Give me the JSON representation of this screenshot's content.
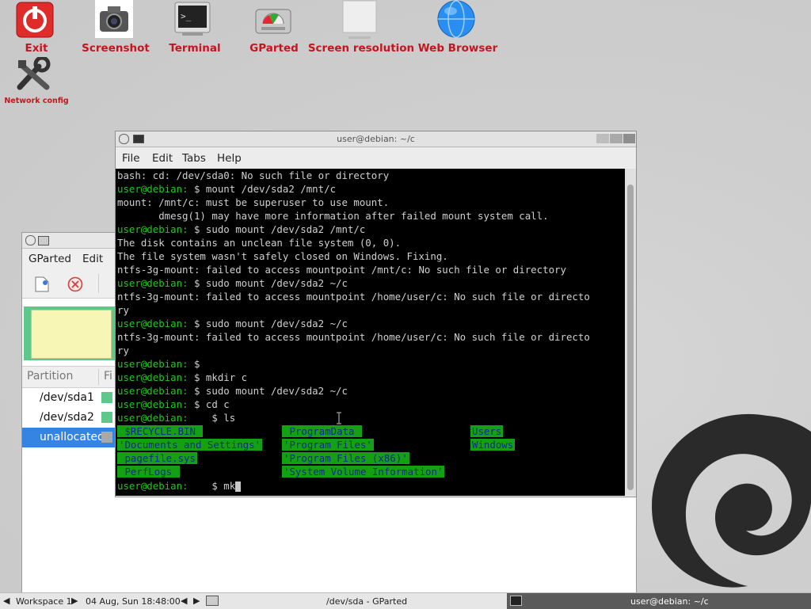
{
  "desktop": {
    "icons": [
      {
        "id": "exit",
        "label": "Exit",
        "icon": "power-icon"
      },
      {
        "id": "screenshot",
        "label": "Screenshot",
        "icon": "camera-icon"
      },
      {
        "id": "terminal",
        "label": "Terminal",
        "icon": "terminal-icon"
      },
      {
        "id": "gparted",
        "label": "GParted",
        "icon": "disk-icon"
      },
      {
        "id": "screen-resolution",
        "label": "Screen resolution",
        "icon": "monitor-icon"
      },
      {
        "id": "web-browser",
        "label": "Web Browser",
        "icon": "globe-icon"
      },
      {
        "id": "network-config",
        "label": "Network config",
        "icon": "tools-icon"
      }
    ]
  },
  "gparted": {
    "menu": [
      "GParted",
      "Edit"
    ],
    "list_header": "Partition",
    "list_header_2": "Fi",
    "rows": [
      "/dev/sda1",
      "/dev/sda2",
      "unallocated"
    ]
  },
  "terminal": {
    "title": "user@debian: ~/c",
    "menu": [
      "File",
      "Edit",
      "Tabs",
      "Help"
    ],
    "lines": [
      {
        "text": "bash: cd: /dev/sda0: No such file or directory"
      },
      {
        "prompt": "user@debian:",
        "rest": " $ mount /dev/sda2 /mnt/c"
      },
      {
        "text": "mount: /mnt/c: must be superuser to use mount."
      },
      {
        "text": "       dmesg(1) may have more information after failed mount system call."
      },
      {
        "prompt": "user@debian:",
        "rest": " $ sudo mount /dev/sda2 /mnt/c"
      },
      {
        "text": "The disk contains an unclean file system (0, 0)."
      },
      {
        "text": "The file system wasn't safely closed on Windows. Fixing."
      },
      {
        "text": "ntfs-3g-mount: failed to access mountpoint /mnt/c: No such file or directory"
      },
      {
        "prompt": "user@debian:",
        "rest": " $ sudo mount /dev/sda2 ~/c"
      },
      {
        "text": "ntfs-3g-mount: failed to access mountpoint /home/user/c: No such file or directo"
      },
      {
        "text": "ry"
      },
      {
        "prompt": "user@debian:",
        "rest": " $ sudo mount /dev/sda2 ~/c"
      },
      {
        "text": "ntfs-3g-mount: failed to access mountpoint /home/user/c: No such file or directo"
      },
      {
        "text": "ry"
      },
      {
        "prompt": "user@debian:",
        "rest": " $"
      },
      {
        "prompt": "user@debian:",
        "rest": " $ mkdir c"
      },
      {
        "prompt": "user@debian:",
        "rest": " $ sudo mount /dev/sda2 ~/c"
      },
      {
        "prompt": "user@debian:",
        "rest": " $ cd c"
      },
      {
        "prompt": "user@debian:",
        "rest": "    $ ls"
      }
    ],
    "ls_items": [
      {
        "text": " $RECYCLE.BIN "
      },
      {
        "text": "'Documents and Settings'"
      },
      {
        "text": " pagefile.sys"
      },
      {
        "text": " PerfLogs "
      },
      {
        "text": " ProgramData "
      },
      {
        "text": "'Program Files'"
      },
      {
        "text": "'Program Files (x86)'"
      },
      {
        "text": "'System Volume Information'"
      },
      {
        "text": "Users"
      },
      {
        "text": "Windows"
      }
    ],
    "last_prompt": "user@debian:",
    "last_rest": "    $ mk"
  },
  "taskbar": {
    "workspace": "Workspace 1",
    "datetime": "04 Aug, Sun 18:48:00",
    "task1": "/dev/sda - GParted",
    "task2": "user@debian: ~/c"
  }
}
